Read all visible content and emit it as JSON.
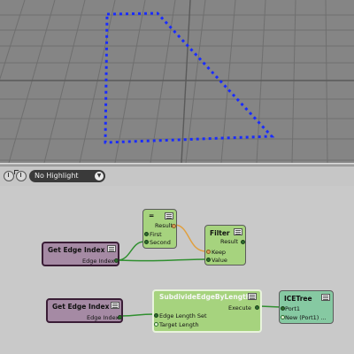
{
  "toolbar": {
    "highlight_select": "No Highlight",
    "icons": [
      "reset-view-icon",
      "refresh-icon"
    ]
  },
  "nodes": {
    "compare": {
      "title": "=",
      "ports": {
        "result": "Result",
        "first": "First",
        "second": "Second"
      }
    },
    "filter": {
      "title": "Filter",
      "ports": {
        "result": "Result",
        "keep": "Keep",
        "value": "Value"
      }
    },
    "get_edge_index_1": {
      "title": "Get Edge Index",
      "ports": {
        "out": "Edge Index"
      }
    },
    "get_edge_index_2": {
      "title": "Get Edge Index",
      "ports": {
        "out": "Edge Index"
      }
    },
    "subdivide": {
      "title": "SubdivideEdgeByLength",
      "ports": {
        "execute": "Execute",
        "set": "Edge Length Set",
        "target": "Target Length"
      }
    },
    "icetree": {
      "title": "ICETree",
      "ports": {
        "port1": "Port1",
        "new": "New (Port1) ..."
      }
    }
  },
  "colors": {
    "viewport_bg": "#858585",
    "grid": "#6f6f6f",
    "selection": "#1a2cff",
    "wire_green": "#2f8f2f",
    "wire_orange": "#e0a040",
    "node_green": "#a6d37e",
    "node_purple": "#a58aa4",
    "node_teal": "#86c9a2"
  }
}
